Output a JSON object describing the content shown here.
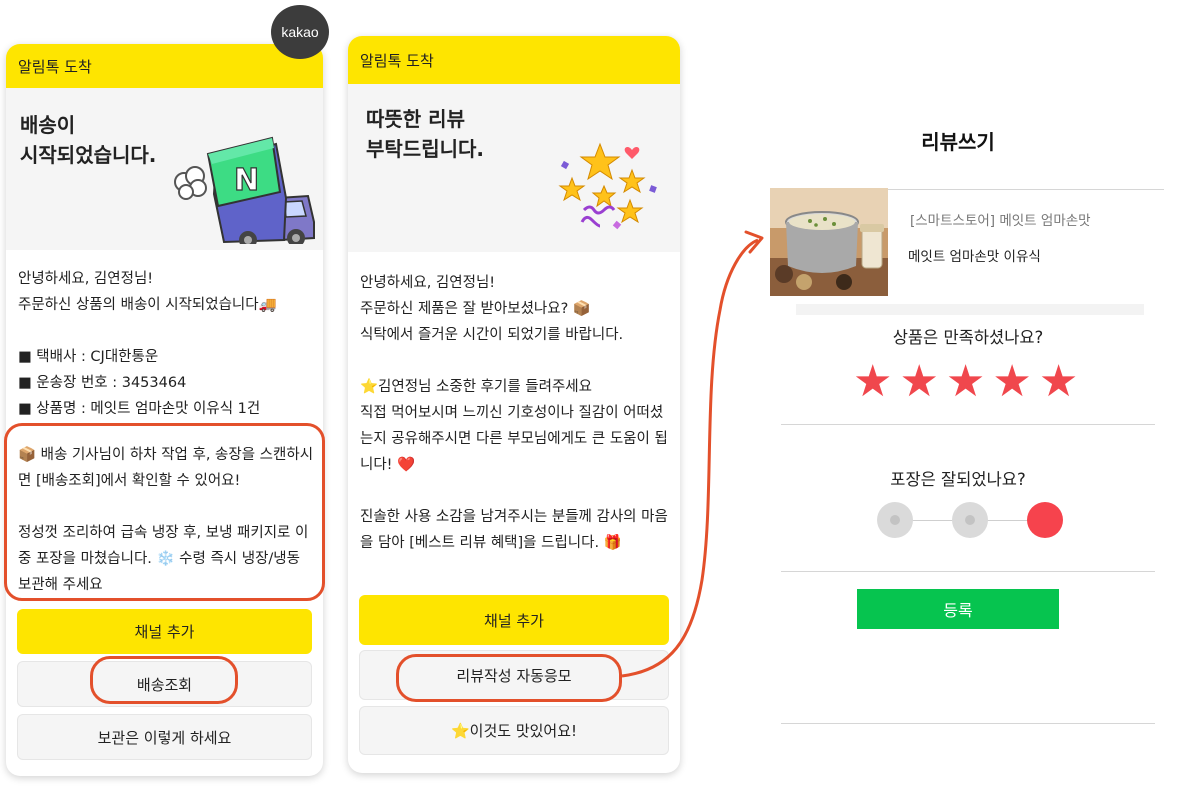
{
  "badge": {
    "kakao_label": "kakao"
  },
  "card1": {
    "header": "알림톡 도착",
    "hero_title": "배송이\n시작되었습니다.",
    "body": "안녕하세요, 김연정님!\n주문하신 상품의 배송이 시작되었습니다🚚\n\n■ 택배사 : CJ대한통운\n■ 운송장 번호 : 3453464\n■ 상품명 : 메잇트 엄마손맛 이유식 1건",
    "highlight": "📦 배송 기사님이 하차 작업 후, 송장을 스캔하시면 [배송조회]에서 확인할 수 있어요!\n\n정성껏 조리하여 급속 냉장 후, 보냉 패키지로 이중 포장을 마쳤습니다. ❄️ 수령 즉시 냉장/냉동 보관해 주세요",
    "buttons": [
      "채널 추가",
      "배송조회",
      "보관은 이렇게 하세요"
    ]
  },
  "card2": {
    "header": "알림톡 도착",
    "hero_title": "따뜻한 리뷰\n부탁드립니다.",
    "body": "안녕하세요, 김연정님!\n주문하신 제품은 잘 받아보셨나요? 📦\n식탁에서 즐거운 시간이 되었기를 바랍니다.\n\n⭐김연정님 소중한 후기를 들려주세요\n직접 먹어보시며 느끼신 기호성이나 질감이 어떠셨는지 공유해주시면 다른 부모님에게도 큰 도움이 됩니다! ❤️\n\n진솔한 사용 소감을 남겨주시는 분들께 감사의 마음을 담아 [베스트 리뷰 혜택]을 드립니다. 🎁",
    "buttons": [
      "채널 추가",
      "리뷰작성 자동응모",
      "⭐이것도 맛있어요!"
    ]
  },
  "review": {
    "title": "리뷰쓰기",
    "product_shop": "[스마트스토어] 메잇트 엄마손맛",
    "product_name": "메잇트 엄마손맛 이유식",
    "question_satisfaction": "상품은 만족하셨나요?",
    "rating": 5,
    "rating_max": 5,
    "question_packaging": "포장은 잘되었나요?",
    "packaging_selected_index": 2,
    "submit_label": "등록"
  },
  "colors": {
    "kakao_yellow": "#fee500",
    "highlight_outline": "#e3502b",
    "star_color": "#f0474d",
    "submit_green": "#06c44f",
    "selected_choice": "#f6434d"
  }
}
